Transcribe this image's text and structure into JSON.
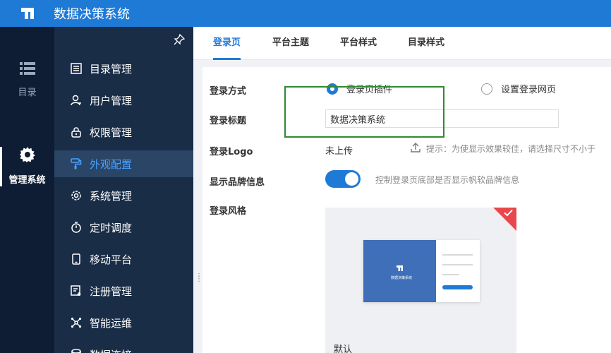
{
  "app": {
    "title": "数据决策系统"
  },
  "rail": {
    "items": [
      {
        "label": "目录",
        "icon": "list-icon"
      },
      {
        "label": "管理系统",
        "icon": "gear-icon"
      }
    ]
  },
  "menu": {
    "items": [
      {
        "label": "目录管理",
        "icon": "catalog-icon"
      },
      {
        "label": "用户管理",
        "icon": "user-icon"
      },
      {
        "label": "权限管理",
        "icon": "lock-icon"
      },
      {
        "label": "外观配置",
        "icon": "paint-roller-icon",
        "active": true
      },
      {
        "label": "系统管理",
        "icon": "settings-icon"
      },
      {
        "label": "定时调度",
        "icon": "timer-icon"
      },
      {
        "label": "移动平台",
        "icon": "mobile-icon"
      },
      {
        "label": "注册管理",
        "icon": "register-icon"
      },
      {
        "label": "智能运维",
        "icon": "network-icon"
      },
      {
        "label": "数据连接",
        "icon": "data-connection-icon"
      }
    ]
  },
  "tabs": [
    {
      "label": "登录页",
      "active": true
    },
    {
      "label": "平台主题"
    },
    {
      "label": "平台样式"
    },
    {
      "label": "目录样式"
    }
  ],
  "form": {
    "login_method_label": "登录方式",
    "login_method_options": [
      "登录页插件",
      "设置登录网页"
    ],
    "login_method_selected": "登录页插件",
    "login_title_label": "登录标题",
    "login_title_value": "数据决策系统",
    "login_logo_label": "登录Logo",
    "login_logo_status": "未上传",
    "login_logo_hint": "提示：为使显示效果较佳，请选择尺寸不小于",
    "brand_info_label": "显示品牌信息",
    "brand_info_enabled": true,
    "brand_info_desc": "控制登录页底部是否显示帆软品牌信息",
    "login_style_label": "登录风格",
    "login_style_option": "默认",
    "preview_title": "数据决策系统"
  },
  "colors": {
    "accent": "#1f7ad6",
    "rail_bg": "#0e1d33",
    "menu_bg": "#1a2d47",
    "highlight_box": "#2e8b2e",
    "check_badge": "#e8474c"
  }
}
